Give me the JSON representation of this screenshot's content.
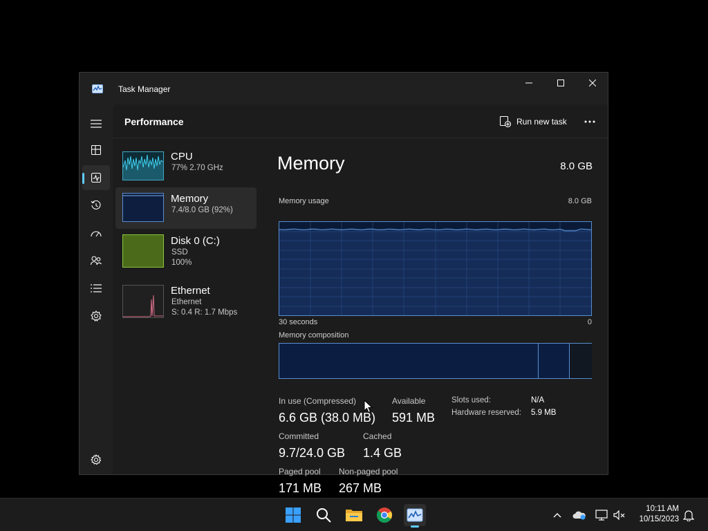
{
  "window": {
    "title": "Task Manager"
  },
  "header": {
    "page_title": "Performance",
    "run_new_task": "Run new task"
  },
  "nav": {
    "items": [
      {
        "icon": "hamburger-menu-icon"
      },
      {
        "icon": "processes-icon"
      },
      {
        "icon": "performance-icon",
        "active": true
      },
      {
        "icon": "app-history-icon"
      },
      {
        "icon": "startup-apps-icon"
      },
      {
        "icon": "users-icon"
      },
      {
        "icon": "details-icon"
      },
      {
        "icon": "services-icon"
      },
      {
        "icon": "settings-icon"
      }
    ]
  },
  "resources": [
    {
      "name": "CPU",
      "sub1": "77%  2.70 GHz",
      "color": "#3fa9c7"
    },
    {
      "name": "Memory",
      "sub1": "7.4/8.0 GB (92%)",
      "color": "#5a8dd0",
      "selected": true
    },
    {
      "name": "Disk 0 (C:)",
      "sub1": "SSD",
      "sub2": "100%",
      "color": "#8dc63f"
    },
    {
      "name": "Ethernet",
      "sub1": "Ethernet",
      "sub2": "S: 0.4  R: 1.7 Mbps",
      "color": "#d46c85"
    }
  ],
  "memory": {
    "title": "Memory",
    "total": "8.0 GB",
    "usage_label": "Memory usage",
    "usage_max": "8.0 GB",
    "time_label": "30 seconds",
    "zero_label": "0",
    "composition_label": "Memory composition",
    "usage_level": 0.92,
    "composition": {
      "in_use": 0.83,
      "modified": 0.1,
      "standby": 0.07
    },
    "stats": {
      "in_use_label": "In use (Compressed)",
      "in_use_value": "6.6 GB (38.0 MB)",
      "available_label": "Available",
      "available_value": "591 MB",
      "committed_label": "Committed",
      "committed_value": "9.7/24.0 GB",
      "cached_label": "Cached",
      "cached_value": "1.4 GB",
      "paged_pool_label": "Paged pool",
      "paged_pool_value": "171 MB",
      "nonpaged_pool_label": "Non-paged pool",
      "nonpaged_pool_value": "267 MB"
    },
    "hw": {
      "slots_label": "Slots used:",
      "slots_value": "N/A",
      "reserved_label": "Hardware reserved:",
      "reserved_value": "5.9 MB"
    }
  },
  "taskbar": {
    "apps": [
      "windows-start-icon",
      "search-icon",
      "file-explorer-icon",
      "chrome-icon",
      "task-manager-icon"
    ],
    "time": "10:11 AM",
    "date": "10/15/2023"
  },
  "colors": {
    "accent": "#60cdff",
    "memory": "#5a8dd0"
  }
}
